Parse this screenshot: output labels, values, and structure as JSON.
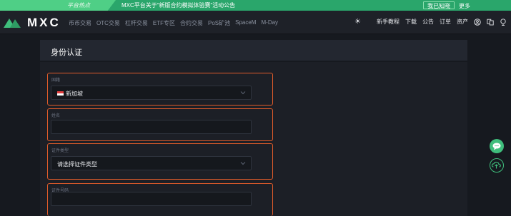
{
  "announcement": {
    "tag": "平台热点",
    "text": "MXC平台关于“新版合约模拟体验赛”活动公告",
    "known_label": "我已知晓",
    "more_label": "更多"
  },
  "brand": {
    "logo_text": "MXC",
    "color": "#3fbe7c"
  },
  "nav": {
    "links": [
      "币币交易",
      "OTC交易",
      "杠杆交易",
      "ETF专区",
      "合约交易",
      "PoS矿池",
      "SpaceM",
      "M-Day"
    ],
    "right_links": [
      "新手教程",
      "下载",
      "公告",
      "订单",
      "资产"
    ]
  },
  "page": {
    "title": "身份认证"
  },
  "form": {
    "country": {
      "label": "国籍",
      "value": "新加坡"
    },
    "name": {
      "label": "姓名",
      "value": ""
    },
    "id_type": {
      "label": "证件类型",
      "value": "请选择证件类型"
    },
    "id_number": {
      "label": "证件号码",
      "value": ""
    }
  },
  "colors": {
    "highlight_border": "#e25c2a",
    "accent": "#3fbe7c"
  }
}
